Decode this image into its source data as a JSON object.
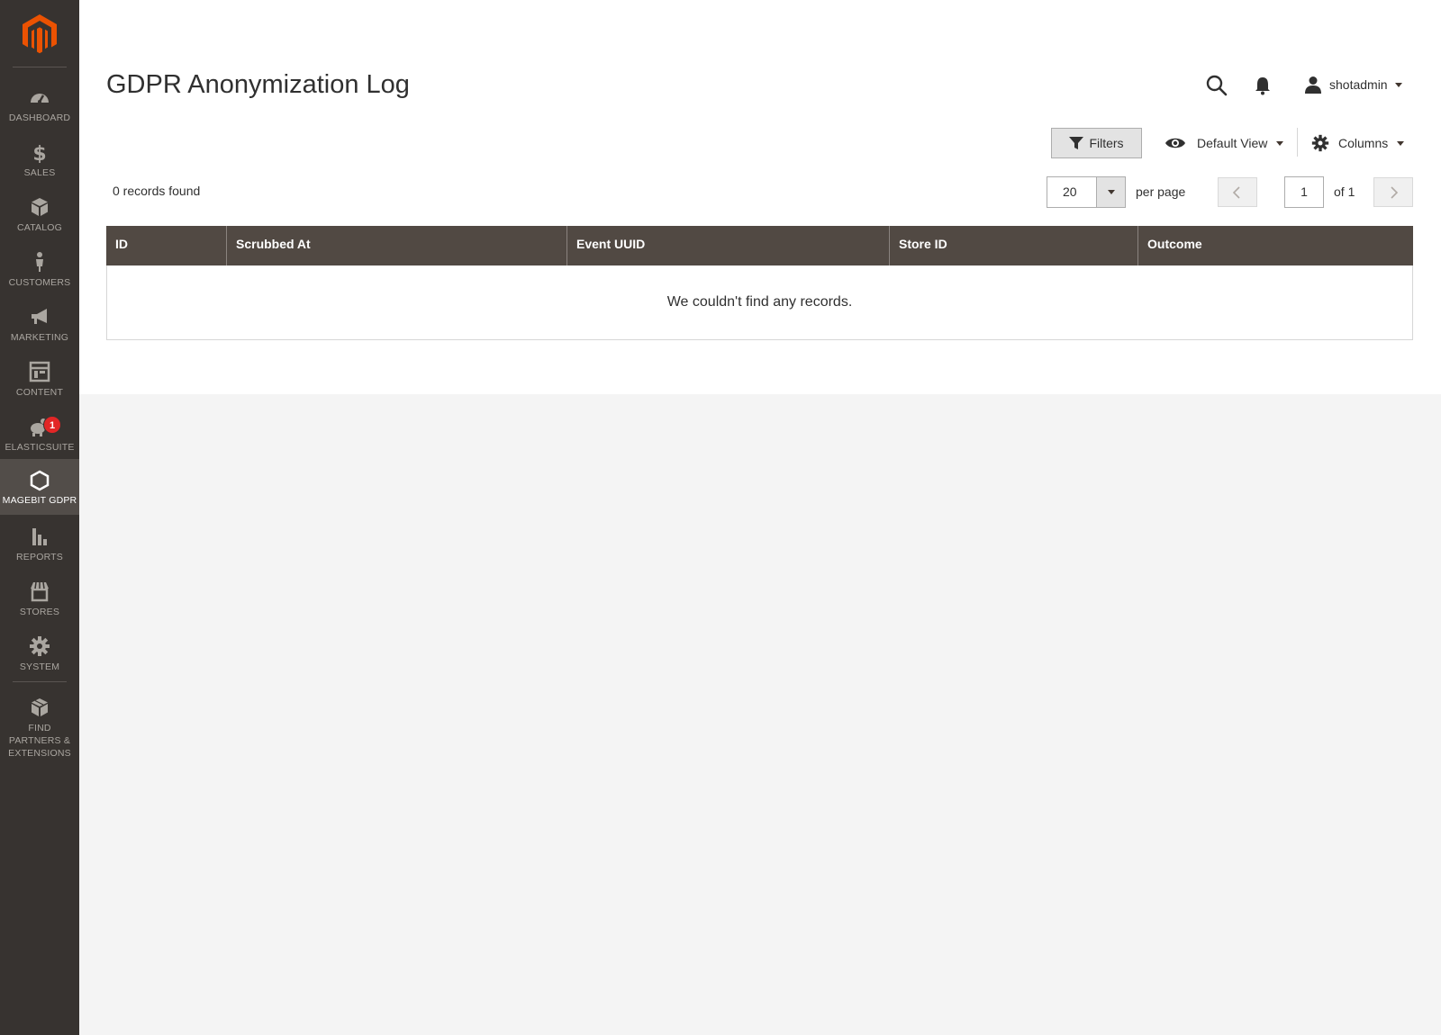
{
  "sidebar": {
    "items": [
      {
        "key": "dashboard",
        "label": "DASHBOARD",
        "icon": "dashboard-icon"
      },
      {
        "key": "sales",
        "label": "SALES",
        "icon": "dollar-icon"
      },
      {
        "key": "catalog",
        "label": "CATALOG",
        "icon": "box-icon"
      },
      {
        "key": "customers",
        "label": "CUSTOMERS",
        "icon": "person-icon"
      },
      {
        "key": "marketing",
        "label": "MARKETING",
        "icon": "megaphone-icon"
      },
      {
        "key": "content",
        "label": "CONTENT",
        "icon": "layout-icon"
      },
      {
        "key": "elasticsuite",
        "label": "ELASTICSUITE",
        "icon": "elasticsuite-icon",
        "badge": "1"
      },
      {
        "key": "magebit-gdpr",
        "label": "MAGEBIT GDPR",
        "icon": "hexagon-icon",
        "active": true
      },
      {
        "key": "reports",
        "label": "REPORTS",
        "icon": "bar-chart-icon"
      },
      {
        "key": "stores",
        "label": "STORES",
        "icon": "store-icon"
      },
      {
        "key": "system",
        "label": "SYSTEM",
        "icon": "gear-icon"
      },
      {
        "key": "partners",
        "label": "FIND PARTNERS & EXTENSIONS",
        "icon": "cubes-icon"
      }
    ]
  },
  "header": {
    "title": "GDPR Anonymization Log",
    "username": "shotadmin"
  },
  "toolbar": {
    "filters_label": "Filters",
    "view_label": "Default View",
    "columns_label": "Columns"
  },
  "grid": {
    "records_found": "0 records found",
    "per_page_value": "20",
    "per_page_label": "per page",
    "current_page": "1",
    "total_pages_label": "of 1",
    "columns": [
      "ID",
      "Scrubbed At",
      "Event UUID",
      "Store ID",
      "Outcome"
    ],
    "empty_message": "We couldn't find any records."
  },
  "colors": {
    "sidebar_bg": "#373330",
    "sidebar_active": "#524d49",
    "grid_header_bg": "#514943",
    "brand_orange": "#eb5202",
    "badge_red": "#e22626"
  }
}
